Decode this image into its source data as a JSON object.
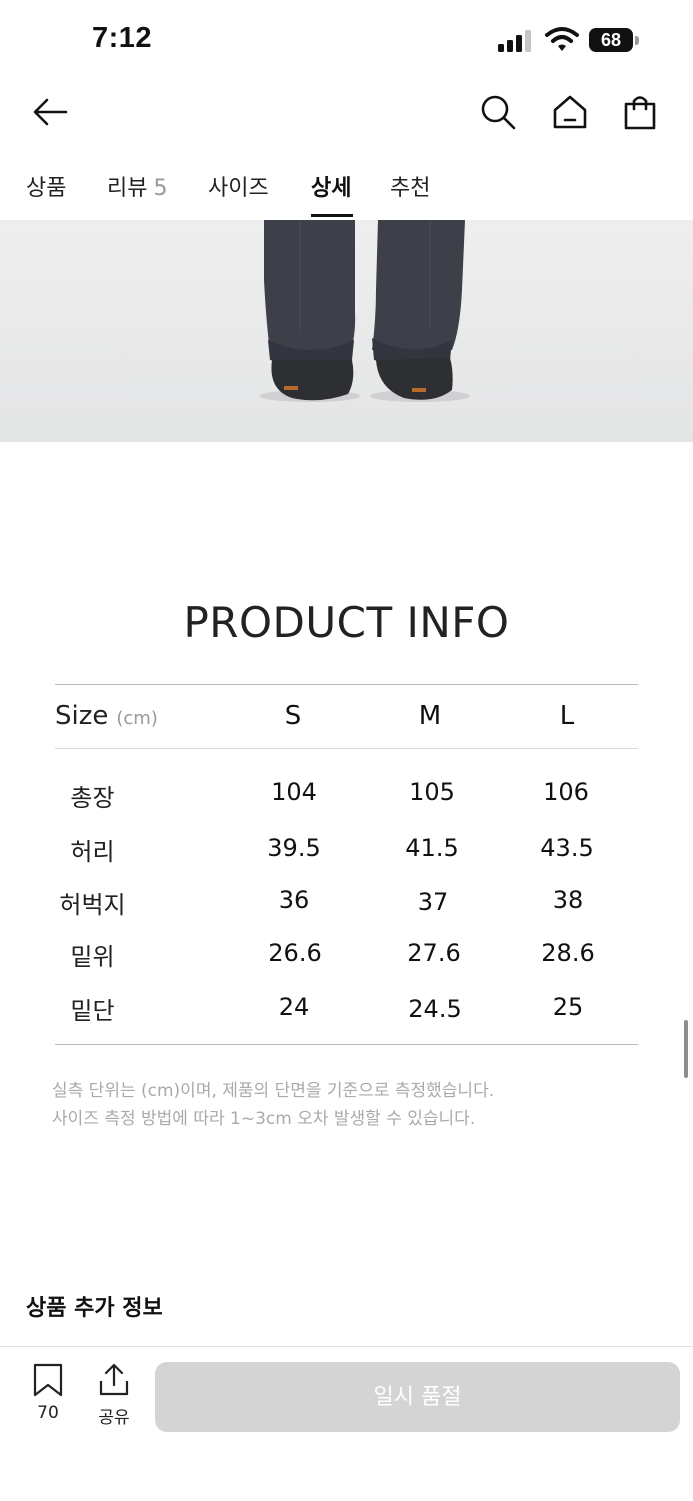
{
  "status_bar": {
    "time": "7:12",
    "battery": "68"
  },
  "header": {
    "back_icon": "arrow-left-icon",
    "search_icon": "search-icon",
    "home_icon": "home-icon",
    "bag_icon": "shopping-bag-icon"
  },
  "tabs": [
    {
      "label": "상품"
    },
    {
      "label": "리뷰",
      "count": "5"
    },
    {
      "label": "사이즈"
    },
    {
      "label": "상세",
      "active": true
    },
    {
      "label": "추천"
    }
  ],
  "product_info": {
    "title": "PRODUCT INFO",
    "size_label": "Size",
    "size_unit": "(cm)",
    "columns": [
      "S",
      "M",
      "L"
    ],
    "rows": [
      {
        "label": "총장",
        "values": [
          "104",
          "105",
          "106"
        ]
      },
      {
        "label": "허리",
        "values": [
          "39.5",
          "41.5",
          "43.5"
        ]
      },
      {
        "label": "허벅지",
        "values": [
          "36",
          "37",
          "38"
        ]
      },
      {
        "label": "밑위",
        "values": [
          "26.6",
          "27.6",
          "28.6"
        ]
      },
      {
        "label": "밑단",
        "values": [
          "24",
          "24.5",
          "25"
        ]
      }
    ],
    "notes": [
      "실측 단위는 (cm)이며, 제품의 단면을 기준으로 측정했습니다.",
      "사이즈 측정 방법에 따라 1~3cm 오차 발생할 수 있습니다."
    ]
  },
  "additional_info_title": "상품 추가 정보",
  "bottom_bar": {
    "bookmark_count": "70",
    "share_label": "공유",
    "soldout_label": "일시 품절"
  },
  "colors": {
    "soldout_bg": "#d4d4d4",
    "hero_bg": "#eceded",
    "pants": "#3d3f49"
  }
}
